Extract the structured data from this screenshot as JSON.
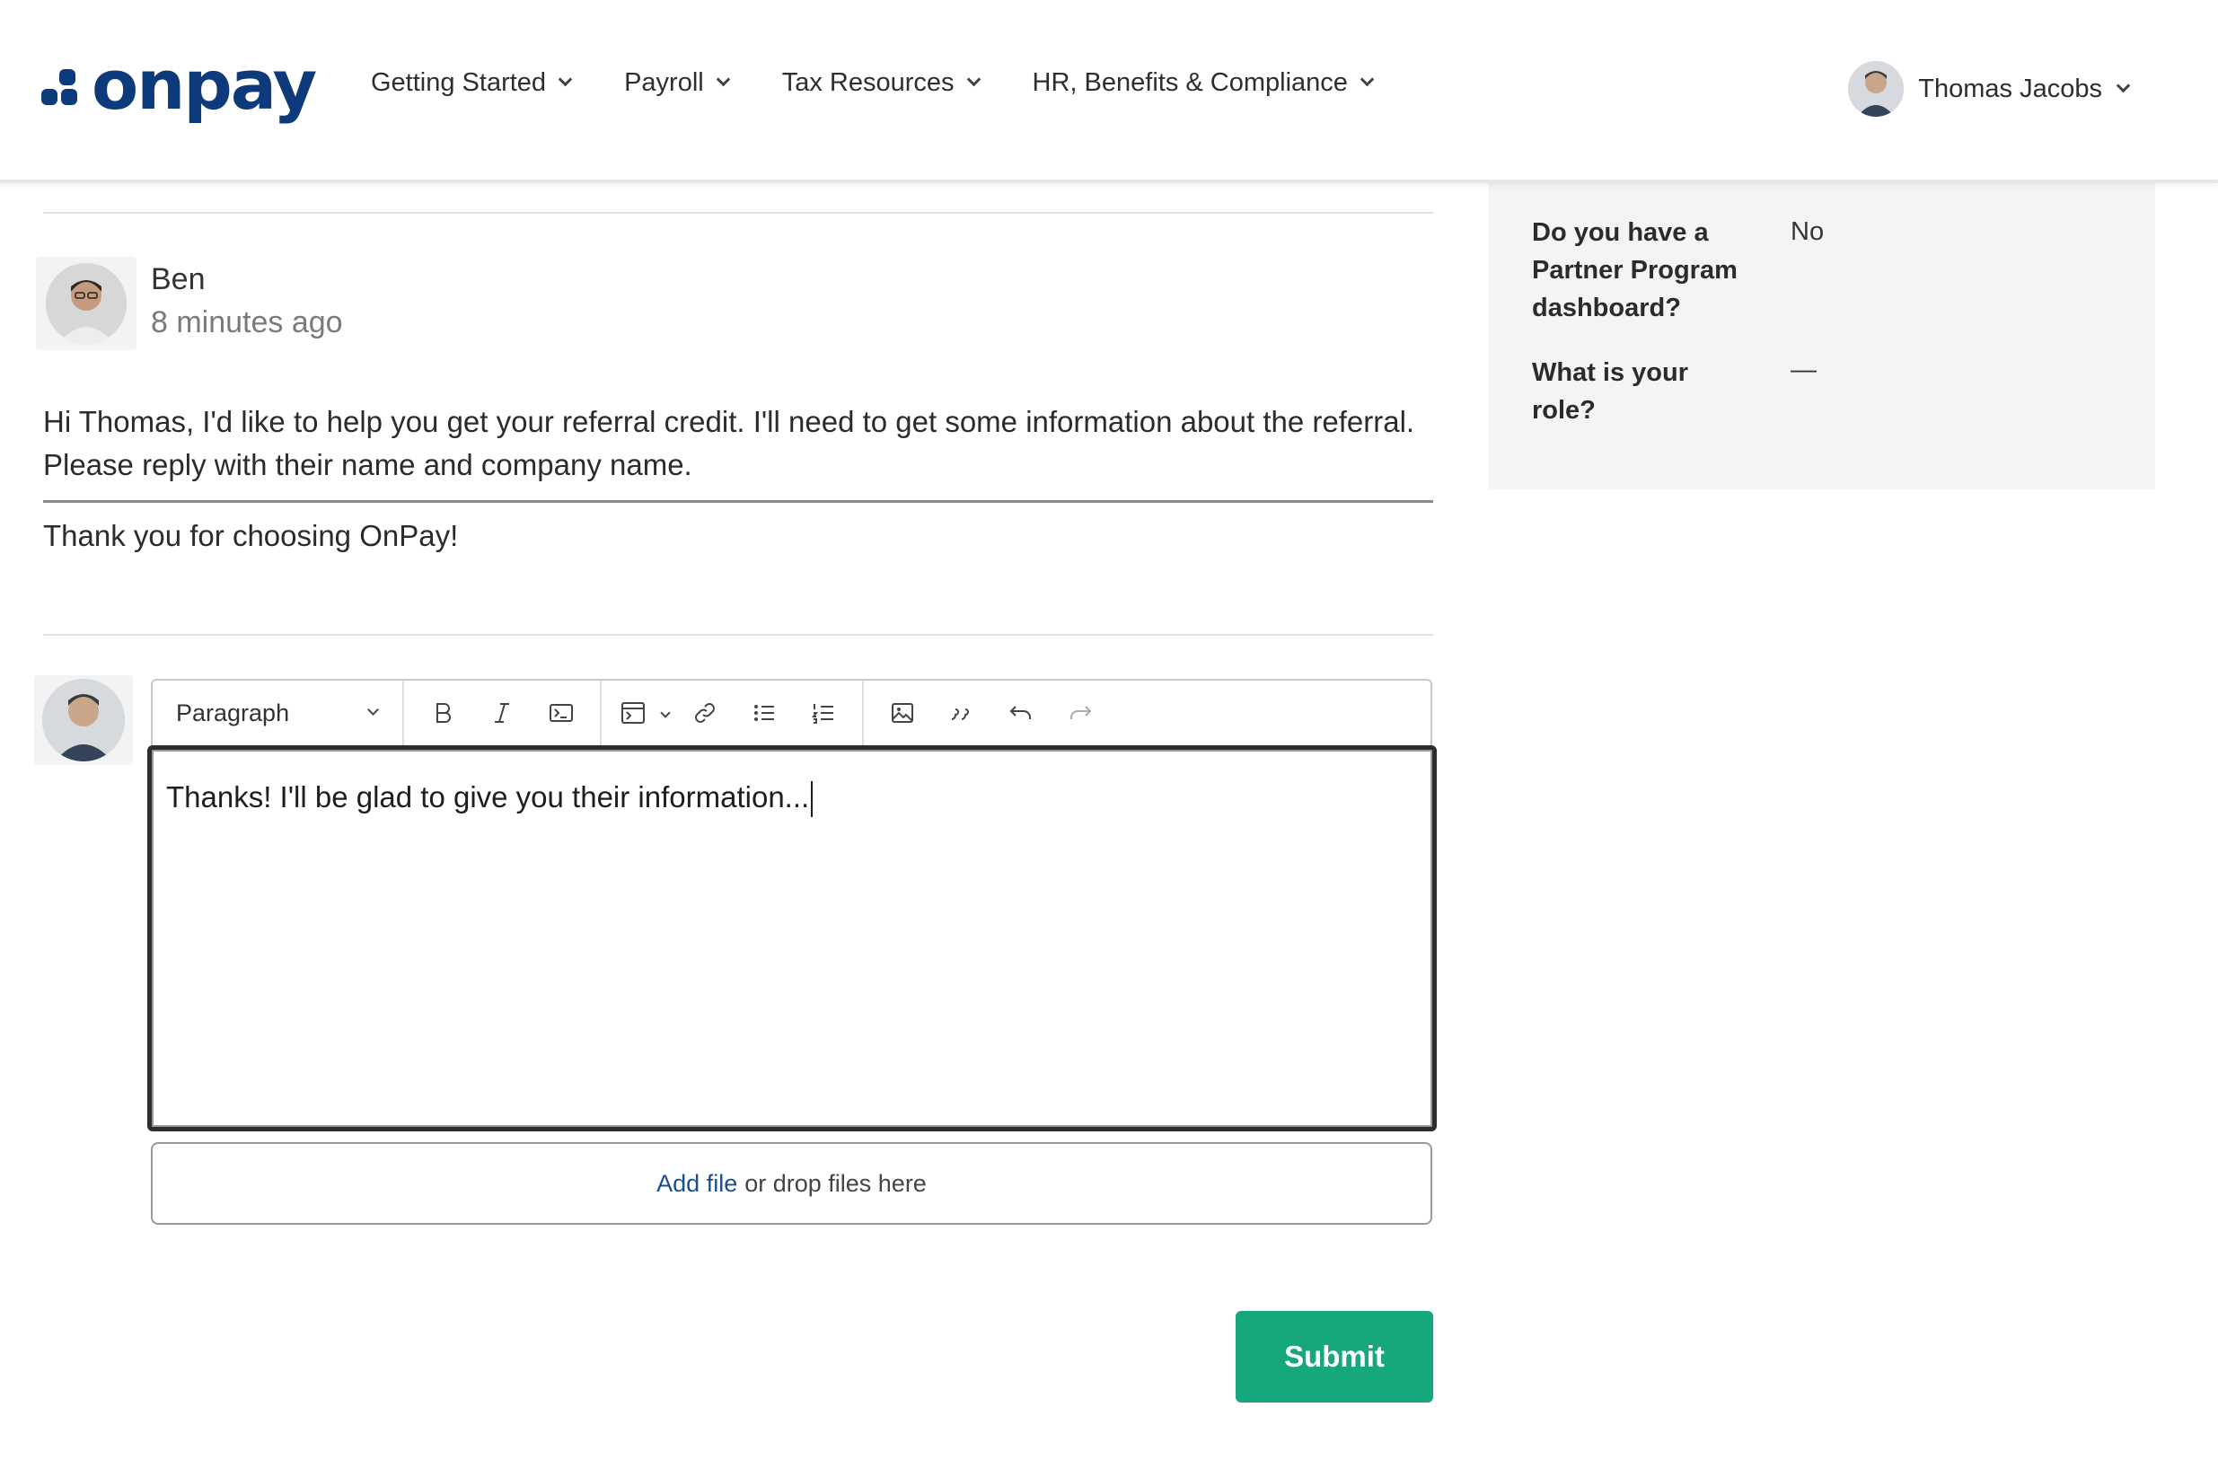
{
  "brand": {
    "logo_text": "onpay",
    "color": "#0d3a7a",
    "accent": "#16a77d"
  },
  "nav": {
    "items": [
      {
        "label": "Getting Started"
      },
      {
        "label": "Payroll"
      },
      {
        "label": "Tax Resources"
      },
      {
        "label": "HR, Benefits & Compliance"
      }
    ],
    "user_name": "Thomas Jacobs"
  },
  "message": {
    "author": "Ben",
    "time": "8 minutes ago",
    "body": "Hi Thomas, I'd like to help you get your referral credit. I'll need to get some information about the referral. Please reply with their name and company name.",
    "signature": "Thank you for choosing OnPay!"
  },
  "editor": {
    "block_style": "Paragraph",
    "text": "Thanks! I'll be glad to give you their information...",
    "toolbar_icons": [
      "bold-icon",
      "italic-icon",
      "code-icon",
      "code-block-icon",
      "dropdown-icon",
      "link-icon",
      "bulleted-list-icon",
      "numbered-list-icon",
      "image-icon",
      "quote-icon",
      "undo-icon",
      "redo-icon"
    ]
  },
  "attachments": {
    "link_label": "Add file",
    "hint": "or drop files here"
  },
  "submit_label": "Submit",
  "sidebar": {
    "fields": [
      {
        "question": "Do you have a Partner Program dashboard?",
        "answer": "No"
      },
      {
        "question": "What is your role?",
        "answer": "—"
      }
    ]
  }
}
